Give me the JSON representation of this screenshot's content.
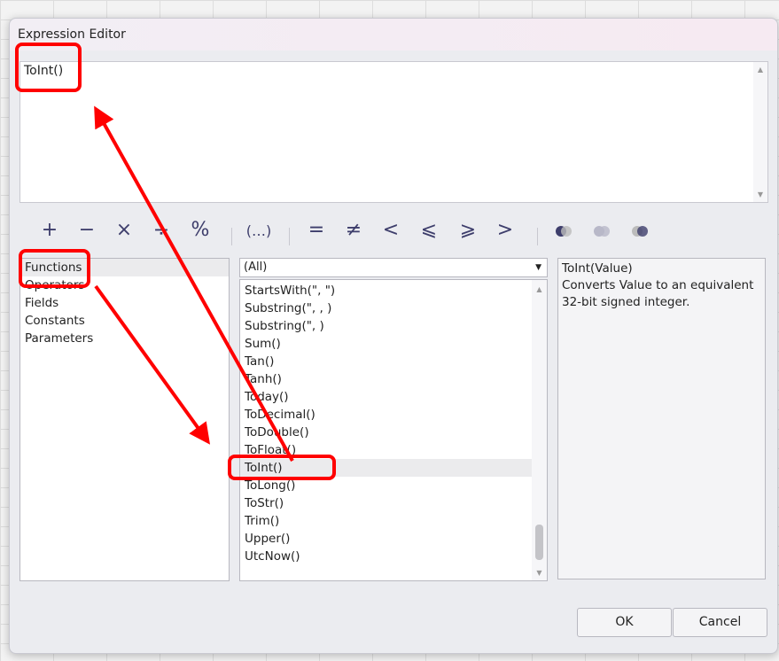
{
  "window": {
    "title": "Expression Editor"
  },
  "editor": {
    "value": "ToInt()"
  },
  "toolbar": {
    "ops": [
      "+",
      "−",
      "×",
      "÷",
      "%"
    ],
    "group": "(…)",
    "compare": [
      "=",
      "≠",
      "<",
      "⩽",
      "⩾",
      ">"
    ],
    "logic": [
      "and-icon",
      "or-icon",
      "not-icon"
    ]
  },
  "categories": [
    "Functions",
    "Operators",
    "Fields",
    "Constants",
    "Parameters"
  ],
  "selected_category": "Functions",
  "filter": {
    "value": "(All)"
  },
  "functions": [
    "StartsWith(\", \")",
    "Substring(\", , )",
    "Substring(\", )",
    "Sum()",
    "Tan()",
    "Tanh()",
    "Today()",
    "ToDecimal()",
    "ToDouble()",
    "ToFloat()",
    "ToInt()",
    "ToLong()",
    "ToStr()",
    "Trim()",
    "Upper()",
    "UtcNow()"
  ],
  "selected_function": "ToInt()",
  "description": {
    "signature": "ToInt(Value)",
    "text": "Converts Value to an equivalent 32-bit signed integer."
  },
  "buttons": {
    "ok": "OK",
    "cancel": "Cancel"
  },
  "annotation_color": "#ff0000"
}
